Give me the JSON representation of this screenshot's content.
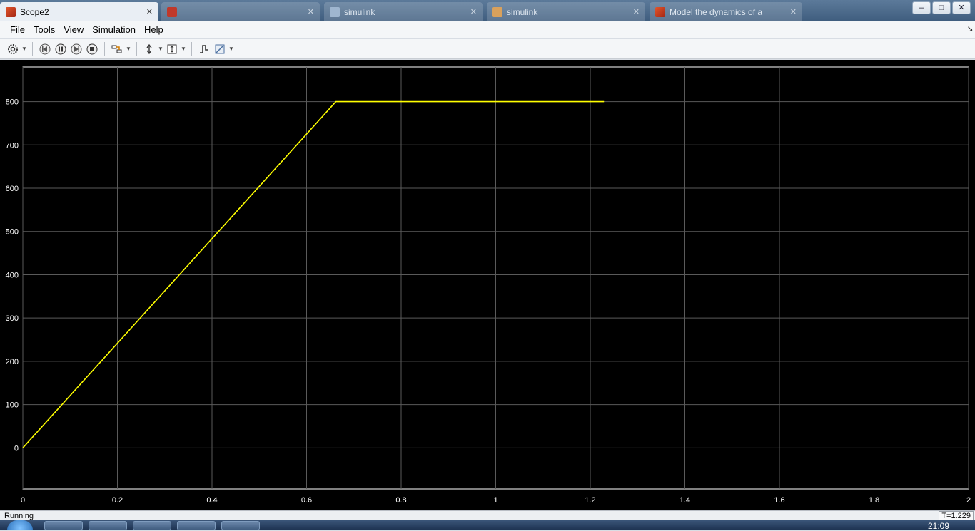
{
  "window": {
    "tabs": [
      {
        "label": "Scope2",
        "active": true,
        "icon": "matlab-icon"
      },
      {
        "label": "",
        "active": false,
        "icon": "browser-tab-icon"
      },
      {
        "label": "simulink",
        "active": false,
        "icon": "document-icon"
      },
      {
        "label": "simulink",
        "active": false,
        "icon": "document-icon"
      },
      {
        "label": "Model the dynamics of a",
        "active": false,
        "icon": "matlab-icon"
      }
    ],
    "controls": {
      "minimize": "–",
      "maximize": "□",
      "close": "✕"
    }
  },
  "menu": {
    "items": [
      "File",
      "Tools",
      "View",
      "Simulation",
      "Help"
    ]
  },
  "toolbar": {
    "buttons": [
      {
        "name": "settings-icon",
        "caret": true
      },
      {
        "name": "step-back-icon",
        "caret": false
      },
      {
        "name": "pause-icon",
        "caret": false
      },
      {
        "name": "step-forward-icon",
        "caret": false
      },
      {
        "name": "stop-icon",
        "caret": false
      },
      {
        "name": "highlight-simulink-block-icon",
        "caret": true
      },
      {
        "name": "zoom-icon",
        "caret": true
      },
      {
        "name": "scale-axes-icon",
        "caret": true
      },
      {
        "name": "triggers-icon",
        "caret": false
      },
      {
        "name": "cursor-measurements-icon",
        "caret": true
      }
    ]
  },
  "status": {
    "state": "Running",
    "time": "T=1.229"
  },
  "taskbar": {
    "clock": "21:09"
  },
  "colors": {
    "plot_background": "#000000",
    "grid": "#5a5a5a",
    "axis_text": "#ffffff",
    "signal": "#ffff00"
  },
  "chart_data": {
    "type": "line",
    "title": "",
    "xlabel": "",
    "ylabel": "",
    "xlim": [
      0,
      2
    ],
    "ylim": [
      -95,
      880
    ],
    "xticks": [
      0,
      0.2,
      0.4,
      0.6,
      0.8,
      1,
      1.2,
      1.4,
      1.6,
      1.8,
      2
    ],
    "xtick_labels": [
      "0",
      "0.2",
      "0.4",
      "0.6",
      "0.8",
      "1",
      "1.2",
      "1.4",
      "1.6",
      "1.8",
      "2"
    ],
    "yticks": [
      0,
      100,
      200,
      300,
      400,
      500,
      600,
      700,
      800
    ],
    "ytick_labels": [
      "0",
      "100",
      "200",
      "300",
      "400",
      "500",
      "600",
      "700",
      "800"
    ],
    "grid": true,
    "series": [
      {
        "x": [
          0,
          0.662,
          1.229
        ],
        "y": [
          0,
          800,
          800
        ],
        "color": "#ffff00"
      }
    ]
  }
}
